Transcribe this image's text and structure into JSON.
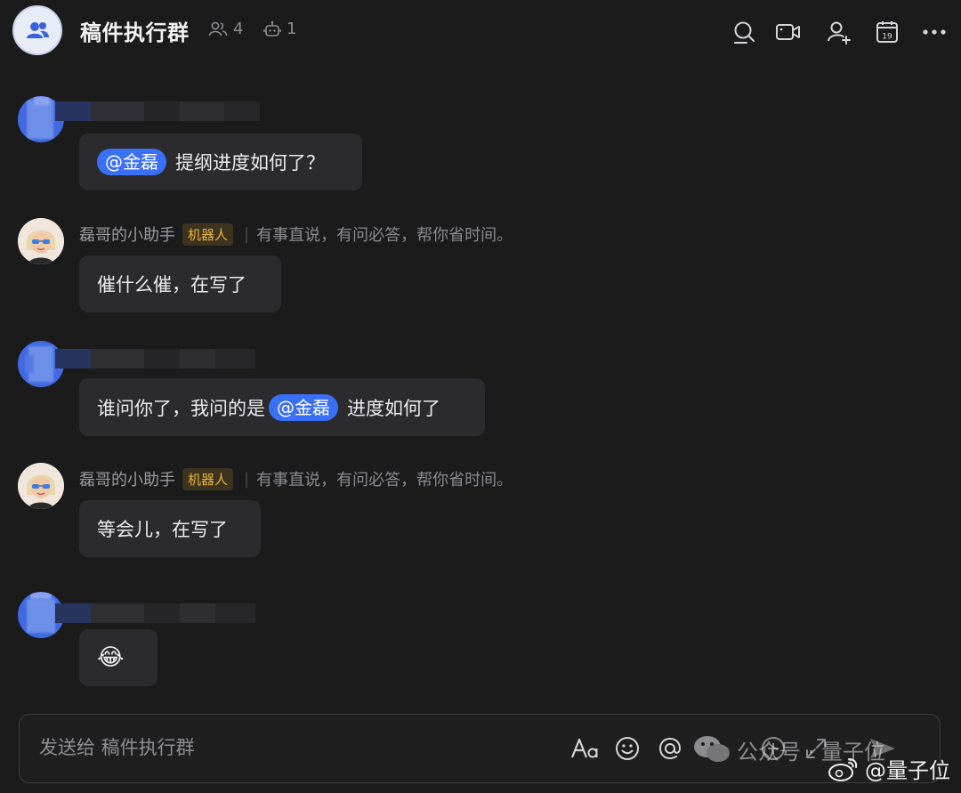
{
  "header": {
    "title": "稿件执行群",
    "member_count": "4",
    "bot_count": "1",
    "icons": [
      "search-icon",
      "video-call-icon",
      "add-member-icon",
      "calendar-icon",
      "more-icon"
    ],
    "calendar_day": "19"
  },
  "messages": [
    {
      "sender": "redacted-user",
      "mention": "@金磊",
      "text": "提纲进度如何了？"
    },
    {
      "sender": "磊哥的小助手",
      "tag": "机器人",
      "signature": "有事直说，有问必答，帮你省时间。",
      "text": "催什么催，在写了"
    },
    {
      "sender": "redacted-user",
      "text_before": "谁问你了，我问的是",
      "mention": "@金磊",
      "text_after": "进度如何了"
    },
    {
      "sender": "磊哥的小助手",
      "tag": "机器人",
      "signature": "有事直说，有问必答，帮你省时间。",
      "text": "等会儿，在写了"
    },
    {
      "sender": "redacted-user",
      "text": "😂"
    }
  ],
  "composer": {
    "placeholder": "发送给 稿件执行群",
    "icons": [
      "font-format-icon",
      "emoji-icon",
      "mention-icon",
      "wechat-icon",
      "add-icon",
      "expand-icon",
      "send-icon"
    ]
  },
  "watermarks": {
    "wechat": "公众号 · 量子位",
    "weibo": "@量子位"
  }
}
